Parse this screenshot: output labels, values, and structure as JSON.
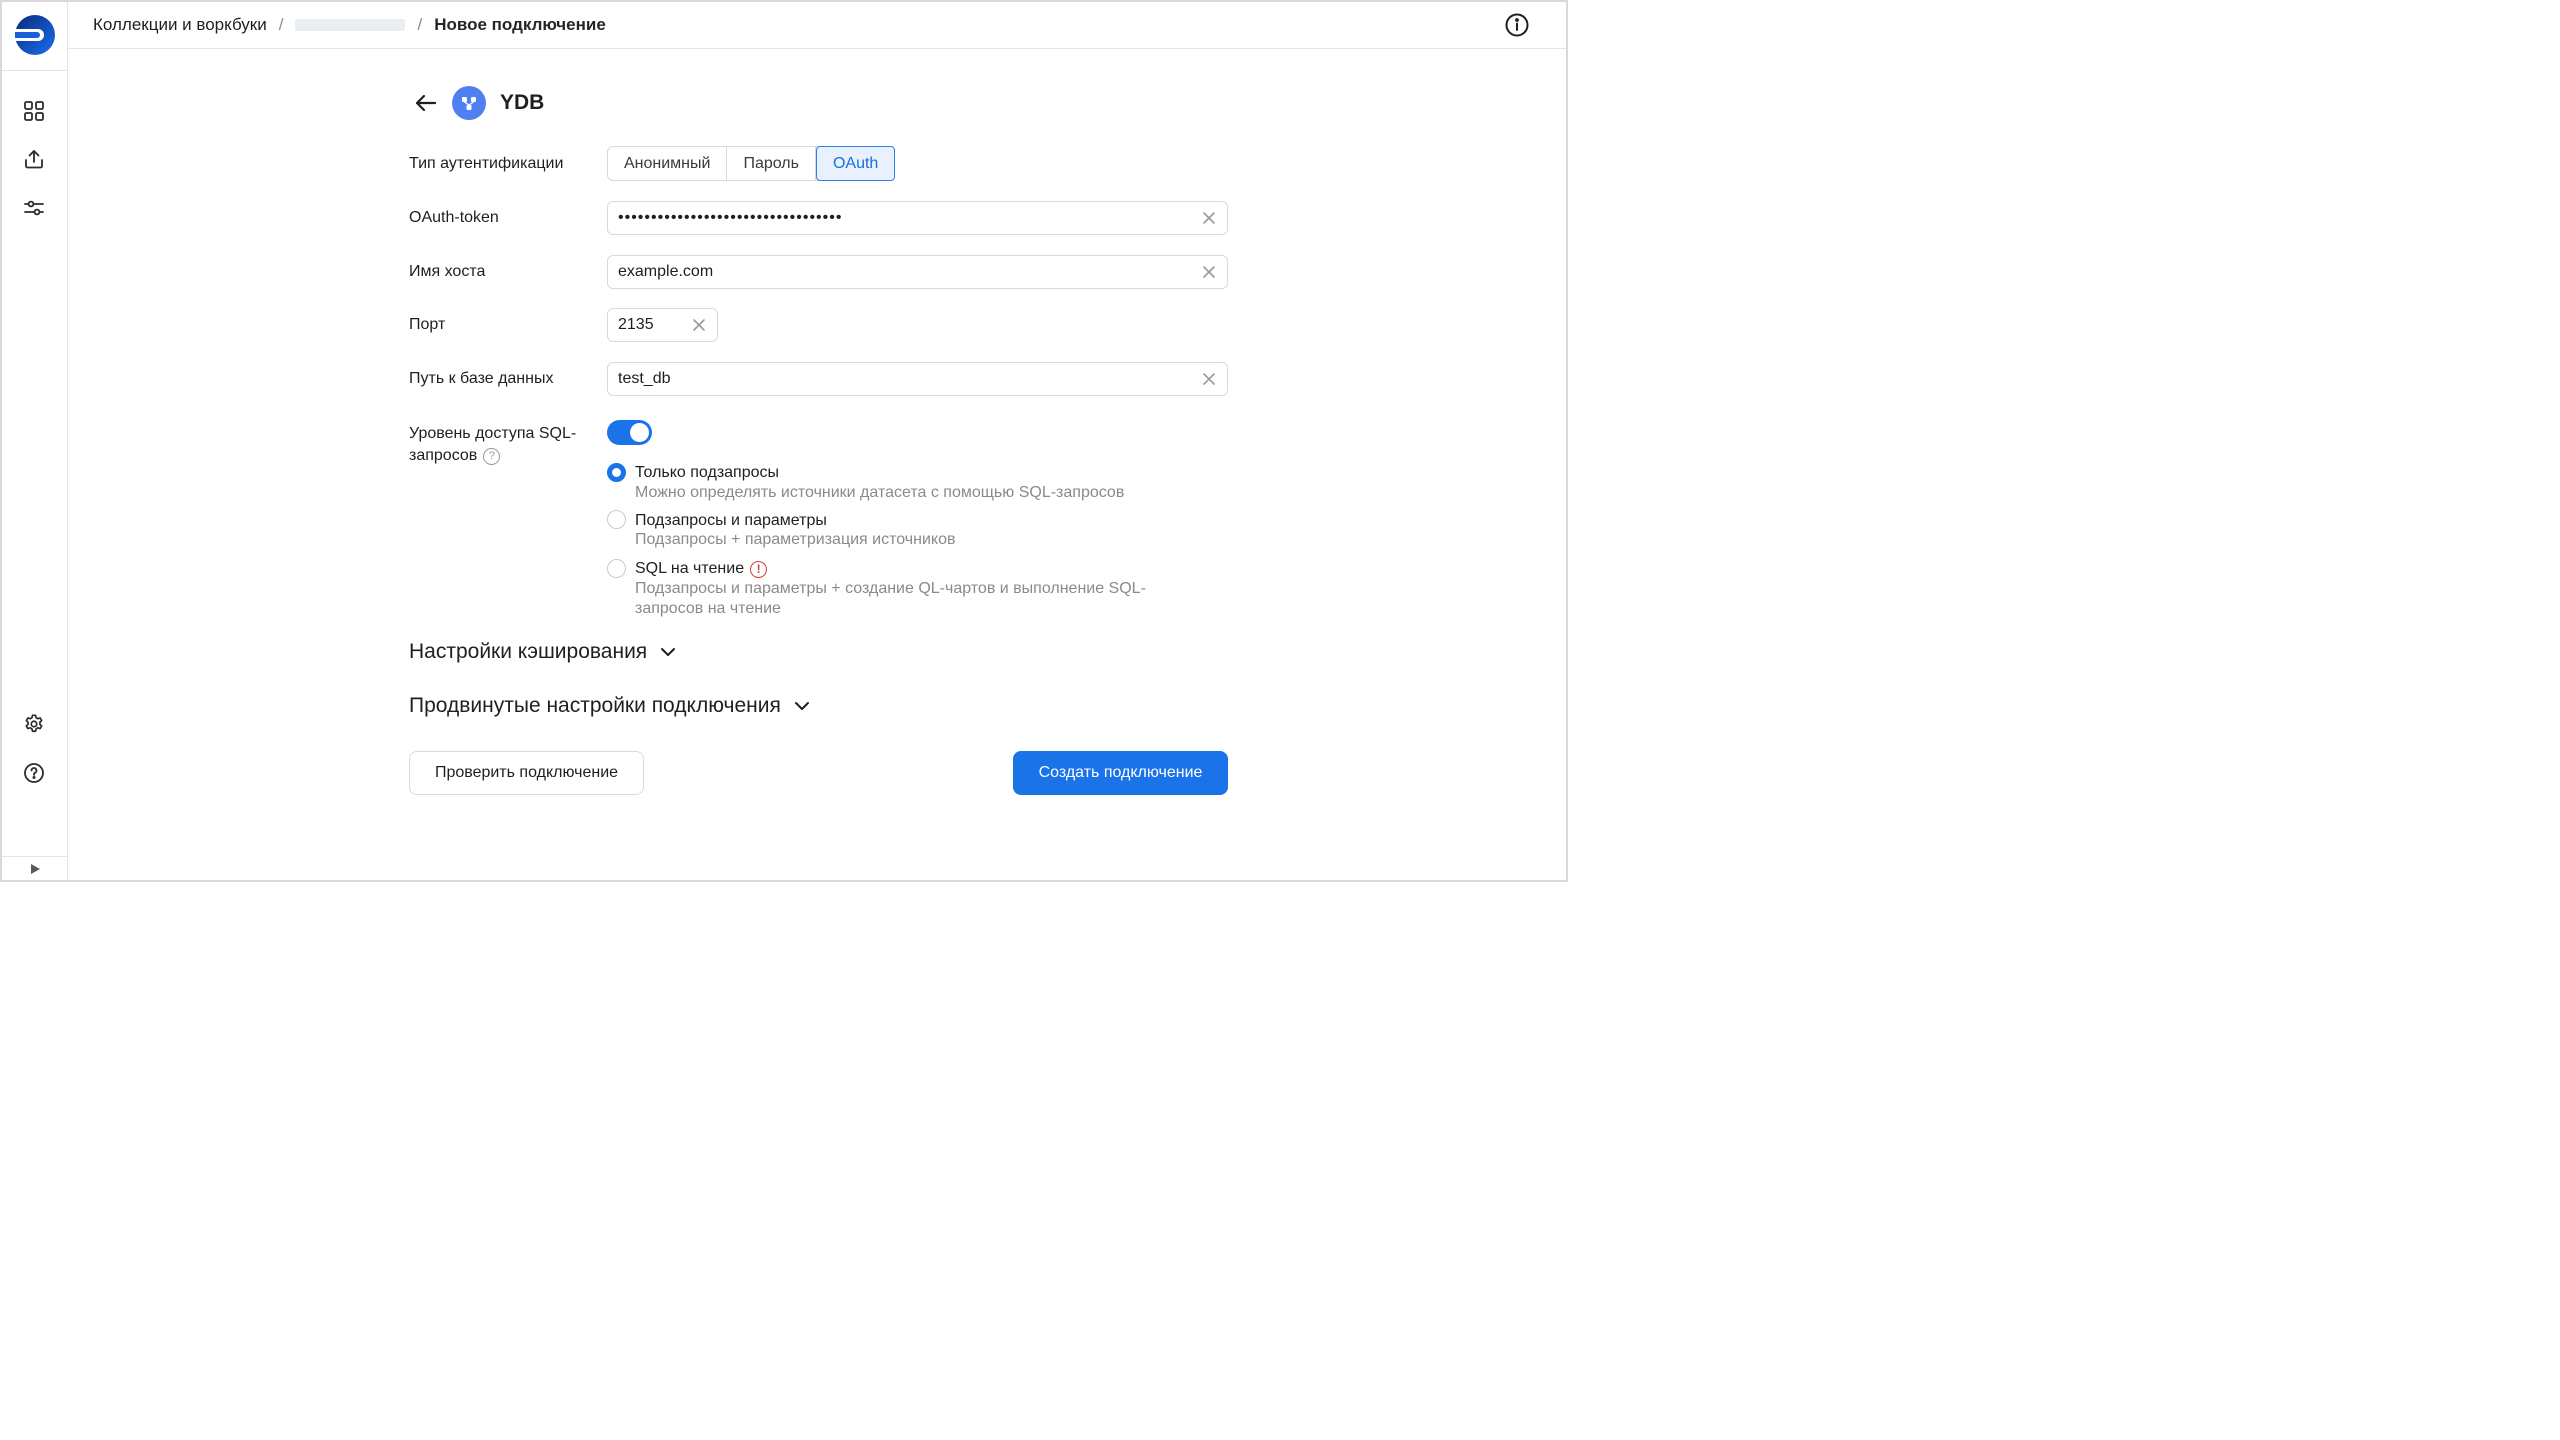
{
  "header": {
    "breadcrumbs": {
      "first": "Коллекции и воркбуки",
      "sep1": "/",
      "sep2": "/",
      "current": "Новое подключение"
    }
  },
  "sidebar": {
    "items": [
      {
        "icon": "grid-icon"
      },
      {
        "icon": "upload-icon"
      },
      {
        "icon": "sliders-icon"
      },
      {
        "icon": "gear-icon"
      },
      {
        "icon": "help-circle-icon"
      }
    ]
  },
  "connection": {
    "title": "YDB",
    "auth_label": "Тип аутентификации",
    "auth_options": [
      "Анонимный",
      "Пароль",
      "OAuth"
    ],
    "auth_selected": "OAuth",
    "token_label": "OAuth-token",
    "token_value": "••••••••••••••••••••••••••••••••••",
    "host_label": "Имя хоста",
    "host_value": "example.com",
    "port_label": "Порт",
    "port_value": "2135",
    "db_label": "Путь к базе данных",
    "db_value": "test_db",
    "sql_label_line1": "Уровень доступа SQL-",
    "sql_label_line2": "запросов",
    "sql_help": "?",
    "sql_enabled": true,
    "sql_levels": [
      {
        "title": "Только подзапросы",
        "desc": "Можно определять источники датасета с помощью SQL-запросов",
        "checked": true
      },
      {
        "title": "Подзапросы и параметры",
        "desc": "Подзапросы + параметризация источников",
        "checked": false
      },
      {
        "title": "SQL на чтение",
        "desc_line1": "Подзапросы и параметры + создание QL-чартов и выполнение SQL-",
        "desc_line2": "запросов на чтение",
        "warning": "!",
        "checked": false
      }
    ],
    "cache_section": "Настройки кэширования",
    "advanced_section": "Продвинутые настройки подключения",
    "check_button": "Проверить подключение",
    "create_button": "Создать подключение"
  },
  "colors": {
    "accent": "#1a73e8",
    "ydb_icon": "#4f7ff0",
    "warning": "#d63c3c"
  }
}
